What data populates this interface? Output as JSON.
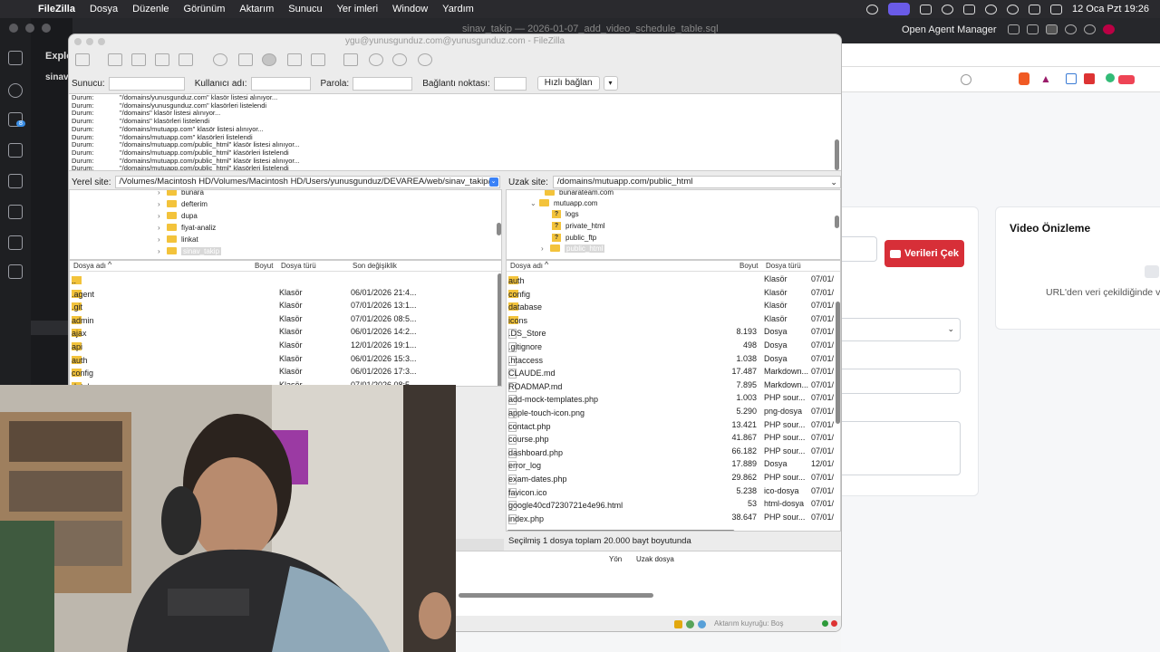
{
  "menubar": {
    "app": "FileZilla",
    "items": [
      "Dosya",
      "Düzenle",
      "Görünüm",
      "Aktarım",
      "Sunucu",
      "Yer imleri",
      "Window",
      "Yardım"
    ],
    "clock": "12 Oca Pzt  19:26"
  },
  "vscode": {
    "title": "sinav_takip — 2026-01-07_add_video_schedule_table.sql",
    "agent_manager": "Open Agent Manager",
    "explorer": "Explo",
    "folder": "sinav",
    "badge": "8"
  },
  "browser": {
    "fetch_button": "Verileri Çek",
    "preview_title": "Video Önizleme",
    "preview_hint": "URL'den veri çekildiğinde vid"
  },
  "filezilla": {
    "title": "ygu@yunusgunduz.com@yunusgunduz.com - FileZilla",
    "quickconnect": {
      "host_label": "Sunucu:",
      "user_label": "Kullanıcı adı:",
      "pass_label": "Parola:",
      "port_label": "Bağlantı noktası:",
      "button": "Hızlı bağlan"
    },
    "log": [
      {
        "k": "Durum:",
        "v": "\"/domains/yunusgunduz.com\" klasör listesi alınıyor..."
      },
      {
        "k": "Durum:",
        "v": "\"/domains/yunusgunduz.com\" klasörleri listelendi"
      },
      {
        "k": "Durum:",
        "v": "\"/domains\" klasör listesi alınıyor..."
      },
      {
        "k": "Durum:",
        "v": "\"/domains\" klasörleri listelendi"
      },
      {
        "k": "Durum:",
        "v": "\"/domains/mutuapp.com\" klasör listesi alınıyor..."
      },
      {
        "k": "Durum:",
        "v": "\"/domains/mutuapp.com\" klasörleri listelendi"
      },
      {
        "k": "Durum:",
        "v": "\"/domains/mutuapp.com/public_html\" klasör listesi alınıyor..."
      },
      {
        "k": "Durum:",
        "v": "\"/domains/mutuapp.com/public_html\" klasörleri listelendi"
      },
      {
        "k": "Durum:",
        "v": "\"/domains/mutuapp.com/public_html\" klasör listesi alınıyor..."
      },
      {
        "k": "Durum:",
        "v": "\"/domains/mutuapp.com/public_html\" klasörleri listelendi"
      }
    ],
    "local": {
      "label": "Yerel site:",
      "path": "/Volumes/Macintosh HD/Volumes/Macintosh HD/Users/yunusgunduz/DEVAREA/web/sinav_takip/",
      "tree": [
        "bunara",
        "defterim",
        "dupa",
        "fiyat-analiz",
        "linkat",
        "sinav_takip"
      ],
      "headers": {
        "name": "Dosya adı",
        "size": "Boyut",
        "type": "Dosya türü",
        "modified": "Son değişiklik"
      },
      "files": [
        {
          "name": "..",
          "type": "",
          "date": ""
        },
        {
          "name": ".agent",
          "type": "Klasör",
          "date": "06/01/2026 21:4..."
        },
        {
          "name": ".git",
          "type": "Klasör",
          "date": "07/01/2026 13:1..."
        },
        {
          "name": "admin",
          "type": "Klasör",
          "date": "07/01/2026 08:5..."
        },
        {
          "name": "ajax",
          "type": "Klasör",
          "date": "06/01/2026 14:2..."
        },
        {
          "name": "api",
          "type": "Klasör",
          "date": "12/01/2026 19:1..."
        },
        {
          "name": "auth",
          "type": "Klasör",
          "date": "06/01/2026 15:3..."
        },
        {
          "name": "config",
          "type": "Klasör",
          "date": "06/01/2026 17:3..."
        },
        {
          "name": "database",
          "type": "Klasör",
          "date": "07/01/2026 08:5..."
        }
      ]
    },
    "remote": {
      "label": "Uzak site:",
      "path": "/domains/mutuapp.com/public_html",
      "tree": [
        {
          "name": "bunarateam.com",
          "kind": "folder",
          "arrow": ""
        },
        {
          "name": "mutuapp.com",
          "kind": "folder",
          "arrow": "⌄"
        },
        {
          "name": "logs",
          "kind": "q",
          "arrow": ""
        },
        {
          "name": "private_html",
          "kind": "q",
          "arrow": ""
        },
        {
          "name": "public_ftp",
          "kind": "q",
          "arrow": ""
        },
        {
          "name": "public_html",
          "kind": "folder",
          "arrow": "›"
        }
      ],
      "headers": {
        "name": "Dosya adı",
        "size": "Boyut",
        "type": "Dosya türü"
      },
      "files": [
        {
          "name": "auth",
          "size": "",
          "type": "Klasör",
          "date": "07/01/",
          "dir": true
        },
        {
          "name": "config",
          "size": "",
          "type": "Klasör",
          "date": "07/01/",
          "dir": true
        },
        {
          "name": "database",
          "size": "",
          "type": "Klasör",
          "date": "07/01/",
          "dir": true
        },
        {
          "name": "icons",
          "size": "",
          "type": "Klasör",
          "date": "07/01/",
          "dir": true
        },
        {
          "name": ".DS_Store",
          "size": "8.193",
          "type": "Dosya",
          "date": "07/01/",
          "dir": false
        },
        {
          "name": ".gitignore",
          "size": "498",
          "type": "Dosya",
          "date": "07/01/",
          "dir": false
        },
        {
          "name": ".htaccess",
          "size": "1.038",
          "type": "Dosya",
          "date": "07/01/",
          "dir": false
        },
        {
          "name": "CLAUDE.md",
          "size": "17.487",
          "type": "Markdown...",
          "date": "07/01/",
          "dir": false
        },
        {
          "name": "ROADMAP.md",
          "size": "7.895",
          "type": "Markdown...",
          "date": "07/01/",
          "dir": false
        },
        {
          "name": "add-mock-templates.php",
          "size": "1.003",
          "type": "PHP sour...",
          "date": "07/01/",
          "dir": false
        },
        {
          "name": "apple-touch-icon.png",
          "size": "5.290",
          "type": "png-dosya",
          "date": "07/01/",
          "dir": false
        },
        {
          "name": "contact.php",
          "size": "13.421",
          "type": "PHP sour...",
          "date": "07/01/",
          "dir": false
        },
        {
          "name": "course.php",
          "size": "41.867",
          "type": "PHP sour...",
          "date": "07/01/",
          "dir": false
        },
        {
          "name": "dashboard.php",
          "size": "66.182",
          "type": "PHP sour...",
          "date": "07/01/",
          "dir": false
        },
        {
          "name": "error_log",
          "size": "17.889",
          "type": "Dosya",
          "date": "12/01/",
          "dir": false
        },
        {
          "name": "exam-dates.php",
          "size": "29.862",
          "type": "PHP sour...",
          "date": "07/01/",
          "dir": false
        },
        {
          "name": "favicon.ico",
          "size": "5.238",
          "type": "ico-dosya",
          "date": "07/01/",
          "dir": false
        },
        {
          "name": "google40cd7230721e4e96.html",
          "size": "53",
          "type": "html-dosya",
          "date": "07/01/",
          "dir": false
        },
        {
          "name": "index.php",
          "size": "38.647",
          "type": "PHP sour...",
          "date": "07/01/",
          "dir": false
        }
      ],
      "status": "Seçilmiş 1 dosya toplam 20.000 bayt boyutunda"
    },
    "queue": {
      "direction": "Yön",
      "remote_file": "Uzak dosya"
    },
    "statusbar": {
      "queue": "Aktarım kuyruğu: Boş"
    }
  }
}
